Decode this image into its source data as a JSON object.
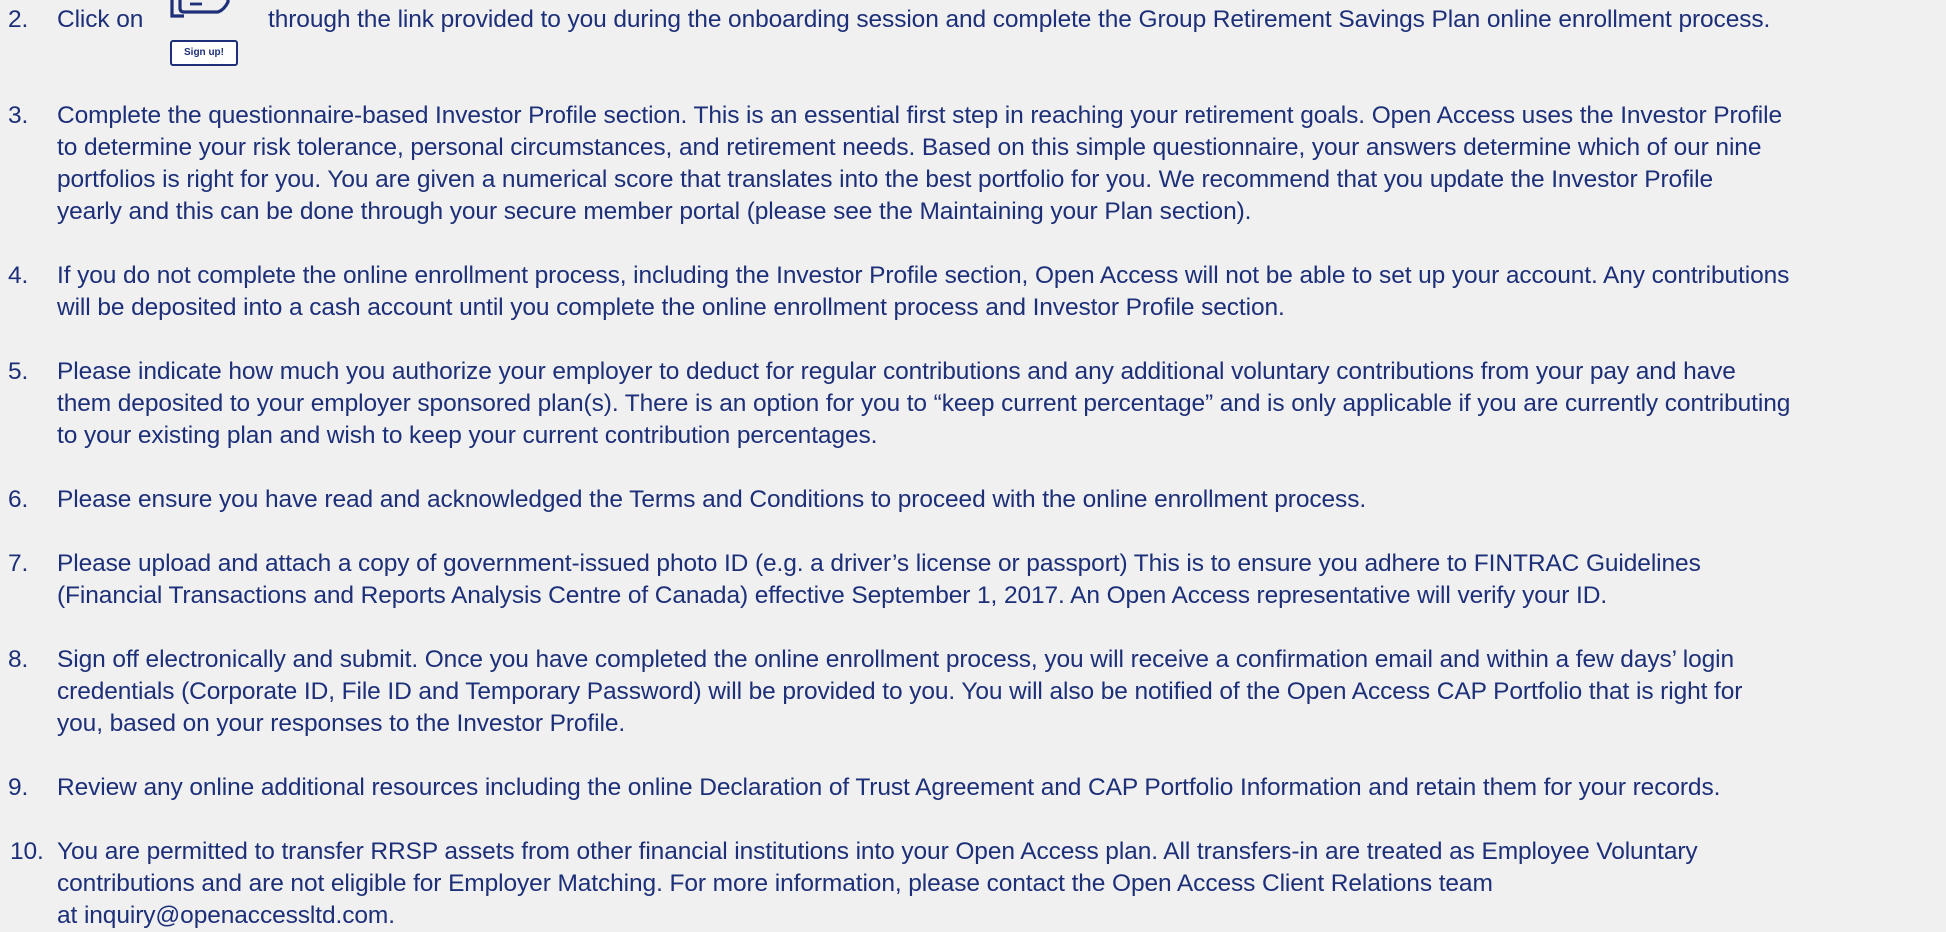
{
  "steps": [
    {
      "number": "2.",
      "text_before": "Click on",
      "badge_label": "Sign up!",
      "text_after": "through the link provided to you during the onboarding session and complete the Group Retirement Savings Plan online enrollment process."
    },
    {
      "number": "3.",
      "lines": [
        "Complete the questionnaire-based Investor Profile section. This is an essential first step in reaching your retirement goals. Open Access uses the Investor Profile",
        "to determine your risk tolerance, personal circumstances, and retirement needs. Based on this simple questionnaire, your answers determine which of our nine",
        "portfolios is right for you. You are given a numerical score that translates into the best portfolio for you. We recommend that you update the Investor Profile",
        "yearly and this can be done through your secure member portal (please see the Maintaining your Plan section)."
      ]
    },
    {
      "number": "4.",
      "lines": [
        "If you do not complete the online enrollment process, including the Investor Profile section, Open Access will not be able to set up your account. Any contributions",
        "will be deposited into a cash account until you complete the online enrollment process and Investor Profile section."
      ]
    },
    {
      "number": "5.",
      "lines": [
        "Please indicate how much you authorize your employer to deduct for regular contributions and any additional voluntary contributions from your pay and have",
        "them deposited to your employer sponsored plan(s). There is an option for you to “keep current percentage” and is only applicable if you are currently contributing",
        "to your existing plan and wish to keep your current contribution percentages."
      ]
    },
    {
      "number": "6.",
      "lines": [
        "Please ensure you have read and acknowledged the Terms and Conditions to proceed with the online enrollment process."
      ]
    },
    {
      "number": "7.",
      "lines": [
        "Please upload and attach a copy of government-issued photo ID (e.g. a driver’s license or passport) This is to ensure you adhere to FINTRAC Guidelines",
        "(Financial Transactions and Reports Analysis Centre of Canada) effective September 1, 2017. An Open Access representative will verify your ID."
      ]
    },
    {
      "number": "8.",
      "lines": [
        "Sign off electronically and submit. Once you have completed the online enrollment process, you will receive a confirmation email and within a few days’ login",
        "credentials (Corporate ID, File ID and Temporary Password)  will be provided to you. You will also be notified of the Open Access CAP Portfolio that is right for",
        "you, based on your responses to the Investor Profile."
      ]
    },
    {
      "number": "9.",
      "lines": [
        "Review any online additional resources including the online Declaration of Trust Agreement and CAP Portfolio Information and retain them for your records."
      ]
    },
    {
      "number": "10.",
      "lines": [
        "You are permitted to transfer RRSP assets from other financial institutions into your Open Access plan. All transfers-in are treated as Employee Voluntary",
        "contributions and are not eligible for Employer Matching. For more information, please contact the Open Access Client Relations team",
        "at inquiry@openaccessltd.com."
      ]
    }
  ],
  "colors": {
    "text": "#1d2f78",
    "background": "#eff0ef"
  },
  "icons": {
    "signup": "document-form-icon"
  }
}
